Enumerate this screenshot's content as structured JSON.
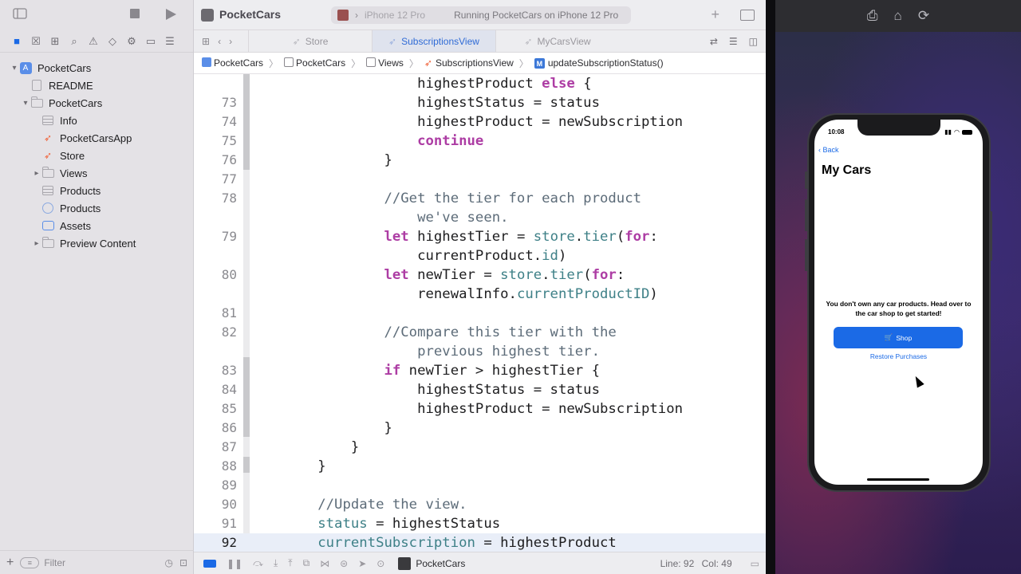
{
  "xcode": {
    "project_title": "PocketCars",
    "scheme": {
      "device": "iPhone 12 Pro",
      "status": "Running PocketCars on iPhone 12 Pro"
    },
    "tabs": [
      "Store",
      "SubscriptionsView",
      "MyCarsView"
    ],
    "active_tab": 1,
    "breadcrumb": [
      "PocketCars",
      "PocketCars",
      "Views",
      "SubscriptionsView",
      "updateSubscriptionStatus()"
    ],
    "navigator": {
      "items": [
        {
          "label": "PocketCars",
          "level": 0,
          "disclosure": "open",
          "icon": "project-icon"
        },
        {
          "label": "README",
          "level": 1,
          "disclosure": "",
          "icon": "doc-icon"
        },
        {
          "label": "PocketCars",
          "level": 1,
          "disclosure": "open",
          "icon": "folder-icon"
        },
        {
          "label": "Info",
          "level": 2,
          "disclosure": "",
          "icon": "plist-icon"
        },
        {
          "label": "PocketCarsApp",
          "level": 2,
          "disclosure": "",
          "icon": "swift-icon"
        },
        {
          "label": "Store",
          "level": 2,
          "disclosure": "",
          "icon": "swift-icon"
        },
        {
          "label": "Views",
          "level": 2,
          "disclosure": "closed",
          "icon": "folder-icon"
        },
        {
          "label": "Products",
          "level": 2,
          "disclosure": "",
          "icon": "plist-icon"
        },
        {
          "label": "Products",
          "level": 2,
          "disclosure": "",
          "icon": "storekit-icon"
        },
        {
          "label": "Assets",
          "level": 2,
          "disclosure": "",
          "icon": "assets-icon"
        },
        {
          "label": "Preview Content",
          "level": 2,
          "disclosure": "closed",
          "icon": "folder-icon"
        }
      ],
      "filter_placeholder": "Filter"
    },
    "code": {
      "current_line": "92",
      "lines": [
        {
          "n": "",
          "tokens": [
            [
              "",
              "                    "
            ],
            [
              "",
              "highestProduct "
            ],
            [
              "kw",
              "else"
            ],
            [
              "",
              " {"
            ]
          ]
        },
        {
          "n": "73",
          "tokens": [
            [
              "",
              "                    highestStatus = status"
            ]
          ]
        },
        {
          "n": "74",
          "tokens": [
            [
              "",
              "                    highestProduct = newSubscription"
            ]
          ]
        },
        {
          "n": "75",
          "tokens": [
            [
              "",
              "                    "
            ],
            [
              "kw",
              "continue"
            ]
          ]
        },
        {
          "n": "76",
          "tokens": [
            [
              "",
              "                }"
            ]
          ]
        },
        {
          "n": "77",
          "tokens": [
            [
              "",
              ""
            ]
          ]
        },
        {
          "n": "78",
          "tokens": [
            [
              "cm",
              "                //Get the tier for each product"
            ]
          ]
        },
        {
          "n": "",
          "tokens": [
            [
              "cm",
              "                    we've seen."
            ]
          ]
        },
        {
          "n": "79",
          "tokens": [
            [
              "",
              "                "
            ],
            [
              "kw",
              "let"
            ],
            [
              "",
              " highestTier = "
            ],
            [
              "id",
              "store"
            ],
            [
              "",
              "."
            ],
            [
              "fn",
              "tier"
            ],
            [
              "",
              "("
            ],
            [
              "kw",
              "for"
            ],
            [
              "",
              ":"
            ]
          ]
        },
        {
          "n": "",
          "tokens": [
            [
              "",
              "                    currentProduct."
            ],
            [
              "id",
              "id"
            ],
            [
              "",
              ")"
            ]
          ]
        },
        {
          "n": "80",
          "tokens": [
            [
              "",
              "                "
            ],
            [
              "kw",
              "let"
            ],
            [
              "",
              " newTier = "
            ],
            [
              "id",
              "store"
            ],
            [
              "",
              "."
            ],
            [
              "fn",
              "tier"
            ],
            [
              "",
              "("
            ],
            [
              "kw",
              "for"
            ],
            [
              "",
              ":"
            ]
          ]
        },
        {
          "n": "",
          "tokens": [
            [
              "",
              "                    renewalInfo."
            ],
            [
              "id",
              "currentProductID"
            ],
            [
              "",
              ")"
            ]
          ]
        },
        {
          "n": "81",
          "tokens": [
            [
              "",
              ""
            ]
          ]
        },
        {
          "n": "82",
          "tokens": [
            [
              "cm",
              "                //Compare this tier with the"
            ]
          ]
        },
        {
          "n": "",
          "tokens": [
            [
              "cm",
              "                    previous highest tier."
            ]
          ]
        },
        {
          "n": "83",
          "tokens": [
            [
              "",
              "                "
            ],
            [
              "kw",
              "if"
            ],
            [
              "",
              " newTier > highestTier {"
            ]
          ]
        },
        {
          "n": "84",
          "tokens": [
            [
              "",
              "                    highestStatus = status"
            ]
          ]
        },
        {
          "n": "85",
          "tokens": [
            [
              "",
              "                    highestProduct = newSubscription"
            ]
          ]
        },
        {
          "n": "86",
          "tokens": [
            [
              "",
              "                }"
            ]
          ]
        },
        {
          "n": "87",
          "tokens": [
            [
              "",
              "            }"
            ]
          ]
        },
        {
          "n": "88",
          "tokens": [
            [
              "",
              "        }"
            ]
          ]
        },
        {
          "n": "89",
          "tokens": [
            [
              "",
              ""
            ]
          ]
        },
        {
          "n": "90",
          "tokens": [
            [
              "cm",
              "        //Update the view."
            ]
          ]
        },
        {
          "n": "91",
          "tokens": [
            [
              "",
              "        "
            ],
            [
              "id",
              "status"
            ],
            [
              "",
              " = highestStatus"
            ]
          ]
        },
        {
          "n": "92",
          "tokens": [
            [
              "",
              "        "
            ],
            [
              "id",
              "currentSubscription"
            ],
            [
              "",
              " = highestProduct"
            ]
          ]
        }
      ]
    },
    "bottom_bar": {
      "target": "PocketCars",
      "line_label": "Line: 92",
      "col_label": "Col: 49"
    }
  },
  "simulator": {
    "status_time": "10:08",
    "back_label": "Back",
    "title": "My Cars",
    "message": "You don't own any car products. Head over to the car shop to get started!",
    "shop_button": "Shop",
    "restore_link": "Restore Purchases"
  },
  "colors": {
    "accent": "#1b6ae6",
    "keyword": "#ad3da4",
    "comment": "#5d6c79",
    "identifier": "#3e8087"
  }
}
